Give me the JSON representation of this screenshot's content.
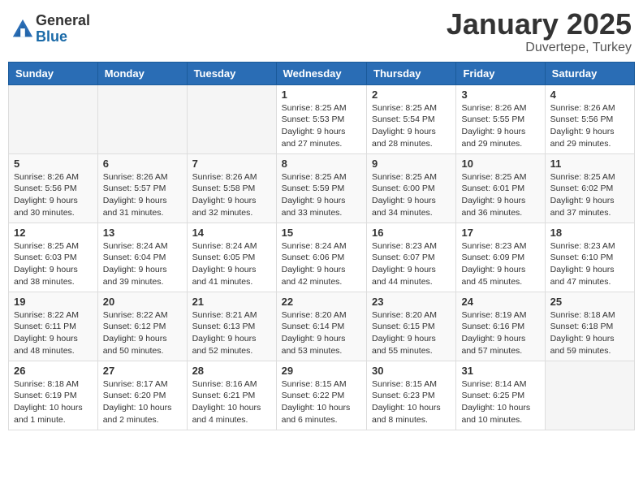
{
  "logo": {
    "general": "General",
    "blue": "Blue"
  },
  "title": "January 2025",
  "location": "Duvertepe, Turkey",
  "days_of_week": [
    "Sunday",
    "Monday",
    "Tuesday",
    "Wednesday",
    "Thursday",
    "Friday",
    "Saturday"
  ],
  "weeks": [
    [
      {
        "day": "",
        "info": ""
      },
      {
        "day": "",
        "info": ""
      },
      {
        "day": "",
        "info": ""
      },
      {
        "day": "1",
        "info": "Sunrise: 8:25 AM\nSunset: 5:53 PM\nDaylight: 9 hours\nand 27 minutes."
      },
      {
        "day": "2",
        "info": "Sunrise: 8:25 AM\nSunset: 5:54 PM\nDaylight: 9 hours\nand 28 minutes."
      },
      {
        "day": "3",
        "info": "Sunrise: 8:26 AM\nSunset: 5:55 PM\nDaylight: 9 hours\nand 29 minutes."
      },
      {
        "day": "4",
        "info": "Sunrise: 8:26 AM\nSunset: 5:56 PM\nDaylight: 9 hours\nand 29 minutes."
      }
    ],
    [
      {
        "day": "5",
        "info": "Sunrise: 8:26 AM\nSunset: 5:56 PM\nDaylight: 9 hours\nand 30 minutes."
      },
      {
        "day": "6",
        "info": "Sunrise: 8:26 AM\nSunset: 5:57 PM\nDaylight: 9 hours\nand 31 minutes."
      },
      {
        "day": "7",
        "info": "Sunrise: 8:26 AM\nSunset: 5:58 PM\nDaylight: 9 hours\nand 32 minutes."
      },
      {
        "day": "8",
        "info": "Sunrise: 8:25 AM\nSunset: 5:59 PM\nDaylight: 9 hours\nand 33 minutes."
      },
      {
        "day": "9",
        "info": "Sunrise: 8:25 AM\nSunset: 6:00 PM\nDaylight: 9 hours\nand 34 minutes."
      },
      {
        "day": "10",
        "info": "Sunrise: 8:25 AM\nSunset: 6:01 PM\nDaylight: 9 hours\nand 36 minutes."
      },
      {
        "day": "11",
        "info": "Sunrise: 8:25 AM\nSunset: 6:02 PM\nDaylight: 9 hours\nand 37 minutes."
      }
    ],
    [
      {
        "day": "12",
        "info": "Sunrise: 8:25 AM\nSunset: 6:03 PM\nDaylight: 9 hours\nand 38 minutes."
      },
      {
        "day": "13",
        "info": "Sunrise: 8:24 AM\nSunset: 6:04 PM\nDaylight: 9 hours\nand 39 minutes."
      },
      {
        "day": "14",
        "info": "Sunrise: 8:24 AM\nSunset: 6:05 PM\nDaylight: 9 hours\nand 41 minutes."
      },
      {
        "day": "15",
        "info": "Sunrise: 8:24 AM\nSunset: 6:06 PM\nDaylight: 9 hours\nand 42 minutes."
      },
      {
        "day": "16",
        "info": "Sunrise: 8:23 AM\nSunset: 6:07 PM\nDaylight: 9 hours\nand 44 minutes."
      },
      {
        "day": "17",
        "info": "Sunrise: 8:23 AM\nSunset: 6:09 PM\nDaylight: 9 hours\nand 45 minutes."
      },
      {
        "day": "18",
        "info": "Sunrise: 8:23 AM\nSunset: 6:10 PM\nDaylight: 9 hours\nand 47 minutes."
      }
    ],
    [
      {
        "day": "19",
        "info": "Sunrise: 8:22 AM\nSunset: 6:11 PM\nDaylight: 9 hours\nand 48 minutes."
      },
      {
        "day": "20",
        "info": "Sunrise: 8:22 AM\nSunset: 6:12 PM\nDaylight: 9 hours\nand 50 minutes."
      },
      {
        "day": "21",
        "info": "Sunrise: 8:21 AM\nSunset: 6:13 PM\nDaylight: 9 hours\nand 52 minutes."
      },
      {
        "day": "22",
        "info": "Sunrise: 8:20 AM\nSunset: 6:14 PM\nDaylight: 9 hours\nand 53 minutes."
      },
      {
        "day": "23",
        "info": "Sunrise: 8:20 AM\nSunset: 6:15 PM\nDaylight: 9 hours\nand 55 minutes."
      },
      {
        "day": "24",
        "info": "Sunrise: 8:19 AM\nSunset: 6:16 PM\nDaylight: 9 hours\nand 57 minutes."
      },
      {
        "day": "25",
        "info": "Sunrise: 8:18 AM\nSunset: 6:18 PM\nDaylight: 9 hours\nand 59 minutes."
      }
    ],
    [
      {
        "day": "26",
        "info": "Sunrise: 8:18 AM\nSunset: 6:19 PM\nDaylight: 10 hours\nand 1 minute."
      },
      {
        "day": "27",
        "info": "Sunrise: 8:17 AM\nSunset: 6:20 PM\nDaylight: 10 hours\nand 2 minutes."
      },
      {
        "day": "28",
        "info": "Sunrise: 8:16 AM\nSunset: 6:21 PM\nDaylight: 10 hours\nand 4 minutes."
      },
      {
        "day": "29",
        "info": "Sunrise: 8:15 AM\nSunset: 6:22 PM\nDaylight: 10 hours\nand 6 minutes."
      },
      {
        "day": "30",
        "info": "Sunrise: 8:15 AM\nSunset: 6:23 PM\nDaylight: 10 hours\nand 8 minutes."
      },
      {
        "day": "31",
        "info": "Sunrise: 8:14 AM\nSunset: 6:25 PM\nDaylight: 10 hours\nand 10 minutes."
      },
      {
        "day": "",
        "info": ""
      }
    ]
  ]
}
